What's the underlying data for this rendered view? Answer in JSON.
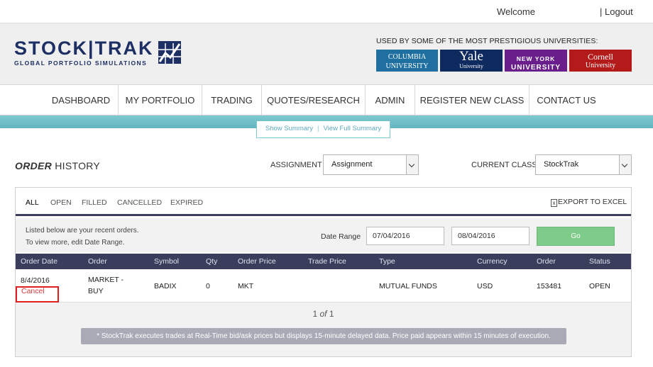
{
  "topbar": {
    "welcome": "Welcome",
    "logout": "| Logout"
  },
  "logo": {
    "brand": "STOCK|TRAK",
    "tagline": "GLOBAL PORTFOLIO SIMULATIONS"
  },
  "universities": {
    "caption": "USED BY SOME OF THE MOST PRESTIGIOUS UNIVERSITIES:",
    "columbia": {
      "l1": "COLUMBIA",
      "l2": "UNIVERSITY"
    },
    "yale": {
      "l1": "Yale",
      "l2": "University"
    },
    "nyu": {
      "l1": "NEW YORK",
      "l2": "UNIVERSITY"
    },
    "cornell": {
      "l1": "Cornell",
      "l2": "University"
    }
  },
  "nav": {
    "items": [
      {
        "label": "DASHBOARD"
      },
      {
        "label": "MY PORTFOLIO"
      },
      {
        "label": "TRADING"
      },
      {
        "label": "QUOTES/RESEARCH"
      },
      {
        "label": "ADMIN"
      },
      {
        "label": "REGISTER NEW CLASS"
      },
      {
        "label": "CONTACT US"
      }
    ]
  },
  "summary": {
    "show": "Show Summary",
    "sep": "|",
    "full": "View Full Summary"
  },
  "page": {
    "title_bold": "ORDER",
    "title_rest": " HISTORY"
  },
  "filters": {
    "assignment_label": "ASSIGNMENT",
    "assignment_value": "Assignment",
    "class_label": "CURRENT CLASS",
    "class_value": "StockTrak"
  },
  "tabs": [
    "ALL",
    "OPEN",
    "FILLED",
    "CANCELLED",
    "EXPIRED"
  ],
  "export_label": "EXPORT TO EXCEL",
  "export_icon": "x",
  "info": {
    "line1": "Listed below are your recent orders.",
    "line2": "To view more, edit Date Range."
  },
  "date_range": {
    "label": "Date Range",
    "from": "07/04/2016",
    "to": "08/04/2016",
    "go": "Go"
  },
  "table": {
    "headers": [
      "Order Date",
      "Order",
      "Symbol",
      "Qty",
      "Order Price",
      "Trade Price",
      "Type",
      "Currency",
      "Order",
      "Status"
    ],
    "rows": [
      {
        "date": "8/4/2016",
        "cancel": "Cancel",
        "order_l1": "MARKET -",
        "order_l2": "BUY",
        "symbol": "BADIX",
        "qty": "0",
        "order_price": "MKT",
        "trade_price": "",
        "type": "MUTUAL FUNDS",
        "currency": "USD",
        "order_no": "153481",
        "status": "OPEN"
      }
    ]
  },
  "pager": {
    "current": "1",
    "of": "of",
    "total": "1"
  },
  "note": "* StockTrak executes trades at Real-Time bid/ask prices but displays 15-minute delayed data. Price paid appears within 15 minutes of execution."
}
